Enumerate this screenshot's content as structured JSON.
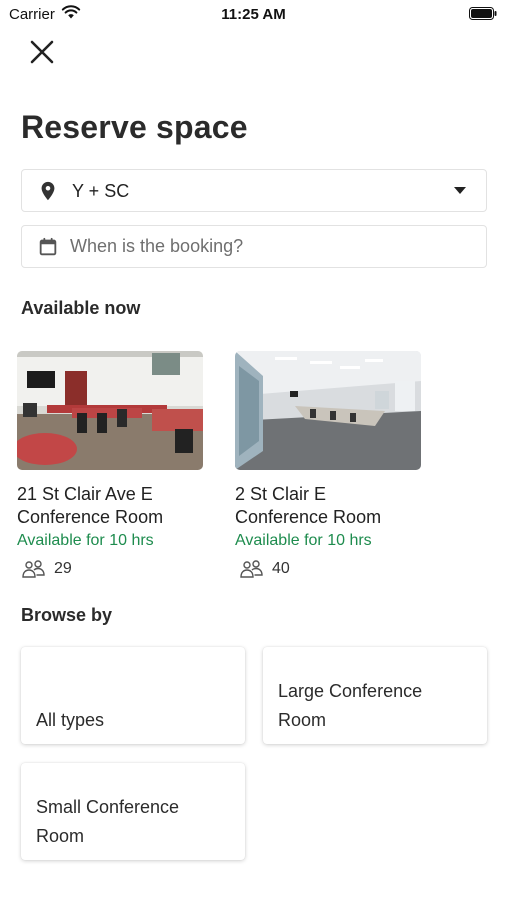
{
  "status_bar": {
    "carrier": "Carrier",
    "time": "11:25 AM",
    "icons": [
      "wifi-icon",
      "battery-icon"
    ]
  },
  "header": {
    "close_icon": "close-icon",
    "title": "Reserve space"
  },
  "filters": {
    "location": {
      "icon": "location-pin-icon",
      "value": "Y + SC",
      "caret_icon": "caret-down-icon"
    },
    "date": {
      "icon": "calendar-icon",
      "placeholder": "When is the booking?",
      "value": ""
    }
  },
  "available_now": {
    "heading": "Available now",
    "rooms": [
      {
        "name_line1": "21 St Clair Ave E",
        "name_line2": "Conference Room",
        "availability": "Available for 10 hrs",
        "capacity": "29",
        "capacity_icon": "people-icon"
      },
      {
        "name_line1": "2 St Clair E",
        "name_line2": "Conference Room",
        "availability": "Available for 10 hrs",
        "capacity": "40",
        "capacity_icon": "people-icon"
      }
    ]
  },
  "browse_by": {
    "heading": "Browse by",
    "items": [
      {
        "label": "All types"
      },
      {
        "label": "Large Conference Room"
      },
      {
        "label": "Small Conference Room"
      }
    ]
  },
  "colors": {
    "available_green": "#1e8c4e",
    "title_text": "#2b2b2b",
    "field_border": "#e2e2e2"
  }
}
